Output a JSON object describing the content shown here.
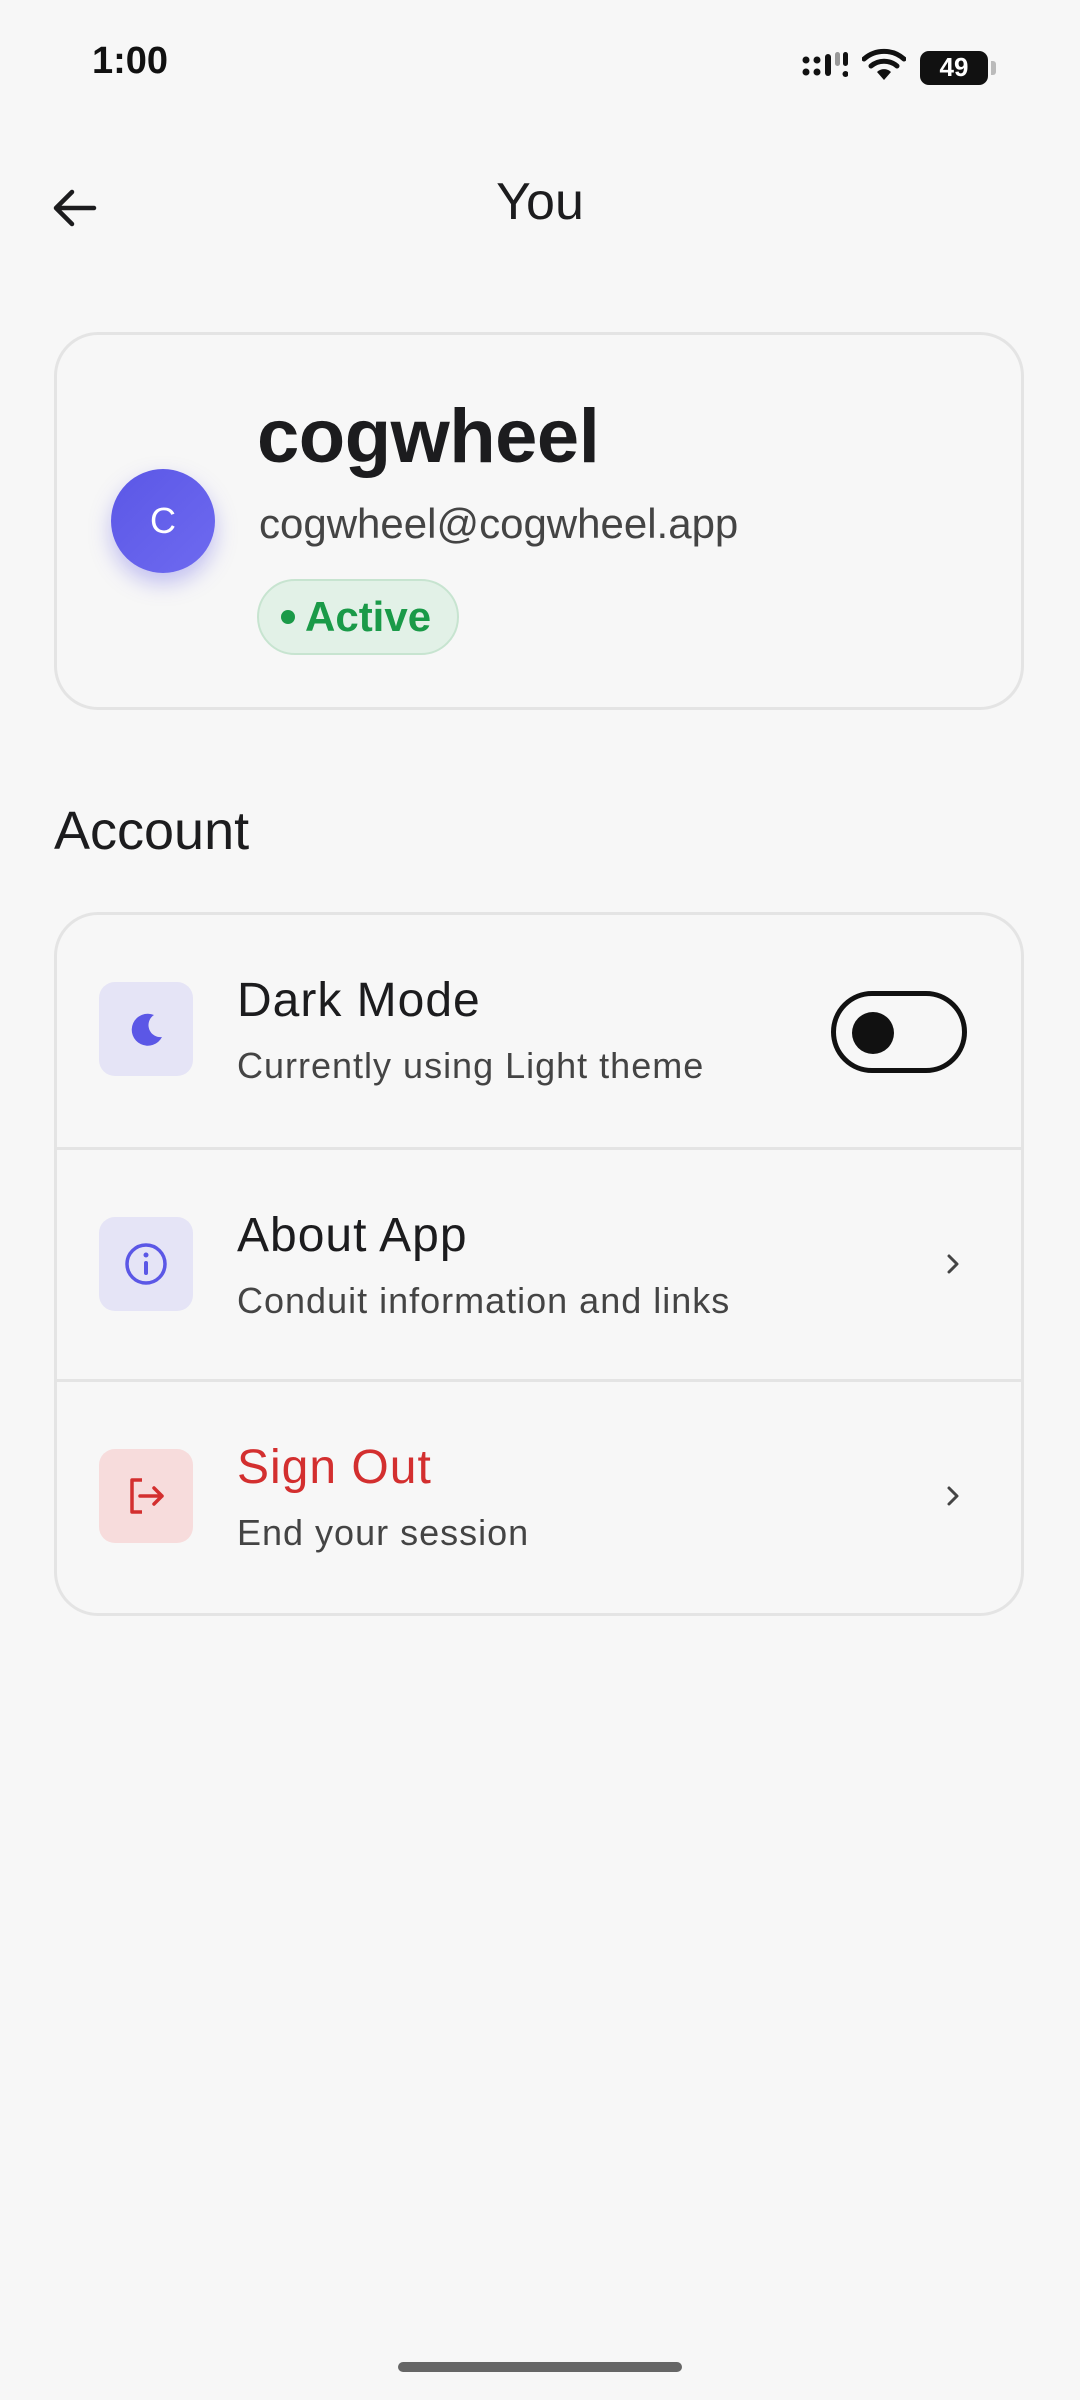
{
  "status_bar": {
    "time": "1:00",
    "battery": "49",
    "icons": [
      "signal-icon",
      "wifi-icon",
      "battery-icon"
    ]
  },
  "header": {
    "title": "You",
    "back_icon": "arrow-left-icon"
  },
  "profile": {
    "avatar_initial": "C",
    "name": "cogwheel",
    "email": "cogwheel@cogwheel.app",
    "status": "Active",
    "status_color": "#1a9a48"
  },
  "account": {
    "section_title": "Account",
    "items": [
      {
        "title": "Dark Mode",
        "subtitle": "Currently using Light theme",
        "icon": "moon-icon",
        "toggle_on": false
      },
      {
        "title": "About App",
        "subtitle": "Conduit information and links",
        "icon": "info-icon"
      },
      {
        "title": "Sign Out",
        "subtitle": "End your session",
        "icon": "logout-icon",
        "color": "#d32f2f"
      }
    ]
  },
  "colors": {
    "accent": "#5b57e6",
    "background": "#f7f7f7",
    "danger": "#d32f2f"
  }
}
